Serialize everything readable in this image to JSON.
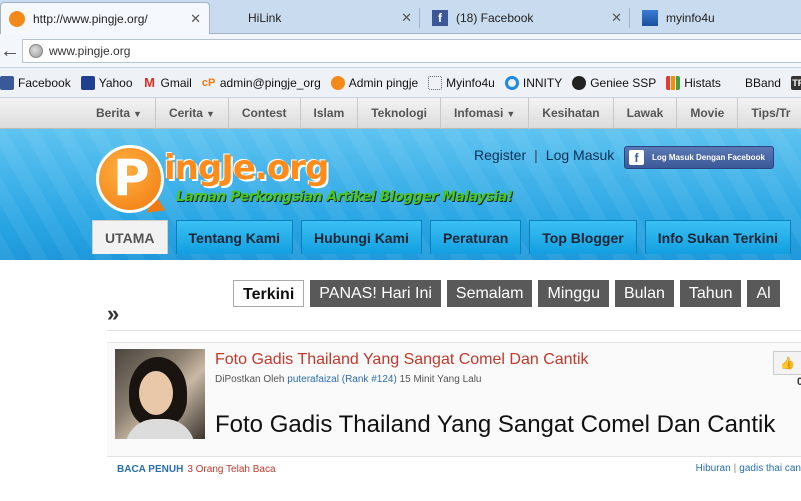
{
  "browser": {
    "tabs": [
      {
        "title": "http://www.pingje.org/",
        "active": true
      },
      {
        "title": "HiLink",
        "active": false
      },
      {
        "title": "(18) Facebook",
        "active": false
      },
      {
        "title": "myinfo4u",
        "active": false
      }
    ],
    "url": "www.pingje.org",
    "bookmarks": [
      {
        "label": "Facebook",
        "icon": "facebook-icon"
      },
      {
        "label": "Yahoo",
        "icon": "yahoo-mail-icon"
      },
      {
        "label": "Gmail",
        "icon": "gmail-icon"
      },
      {
        "label": "admin@pingje_org",
        "icon": "cpanel-icon"
      },
      {
        "label": "Admin pingje",
        "icon": "pingje-icon"
      },
      {
        "label": "Myinfo4u",
        "icon": "blank-page-icon"
      },
      {
        "label": "INNITY",
        "icon": "innity-icon"
      },
      {
        "label": "Geniee SSP",
        "icon": "geniee-icon"
      },
      {
        "label": "Histats",
        "icon": "histats-icon"
      },
      {
        "label": "BBand",
        "icon": "blank-icon"
      },
      {
        "label": "To",
        "icon": "tp-icon"
      }
    ]
  },
  "site": {
    "nav": [
      {
        "label": "Berita",
        "dropdown": true
      },
      {
        "label": "Cerita",
        "dropdown": true
      },
      {
        "label": "Contest",
        "dropdown": false
      },
      {
        "label": "Islam",
        "dropdown": false
      },
      {
        "label": "Teknologi",
        "dropdown": false
      },
      {
        "label": "Infomasi",
        "dropdown": true
      },
      {
        "label": "Kesihatan",
        "dropdown": false
      },
      {
        "label": "Lawak",
        "dropdown": false
      },
      {
        "label": "Movie",
        "dropdown": false
      },
      {
        "label": "Tips/Tr",
        "dropdown": false
      }
    ],
    "logo_text": "ingJe.org",
    "logo_letter": "P",
    "tagline": "Laman Perkongsian Artikel Blogger Malaysia!",
    "register": "Register",
    "login": "Log Masuk",
    "fb_login": "Log Masuk Dengan Facebook",
    "main_tabs": [
      {
        "label": "UTAMA",
        "active": true
      },
      {
        "label": "Tentang Kami",
        "active": false
      },
      {
        "label": "Hubungi Kami",
        "active": false
      },
      {
        "label": "Peraturan",
        "active": false
      },
      {
        "label": "Top Blogger",
        "active": false
      },
      {
        "label": "Info Sukan Terkini",
        "active": false
      }
    ],
    "filters": [
      {
        "label": "Terkini",
        "active": true
      },
      {
        "label": "PANAS! Hari Ini",
        "active": false
      },
      {
        "label": "Semalam",
        "active": false
      },
      {
        "label": "Minggu",
        "active": false
      },
      {
        "label": "Bulan",
        "active": false
      },
      {
        "label": "Tahun",
        "active": false
      },
      {
        "label": "Al",
        "active": false
      }
    ],
    "chevron": "»"
  },
  "post": {
    "title": "Foto Gadis Thailand Yang Sangat Comel Dan Cantik",
    "meta_prefix": "DiPostkan Oleh",
    "author": "puterafaizal (Rank #124)",
    "time": "15 Minit Yang Lalu",
    "big_title": "Foto Gadis Thailand Yang Sangat Comel Dan Cantik",
    "like_count": "0",
    "read_more": "BACA PENUH",
    "readers": "3 Orang Telah Baca",
    "category": "Hiburan",
    "tag": "gadis thai can"
  }
}
